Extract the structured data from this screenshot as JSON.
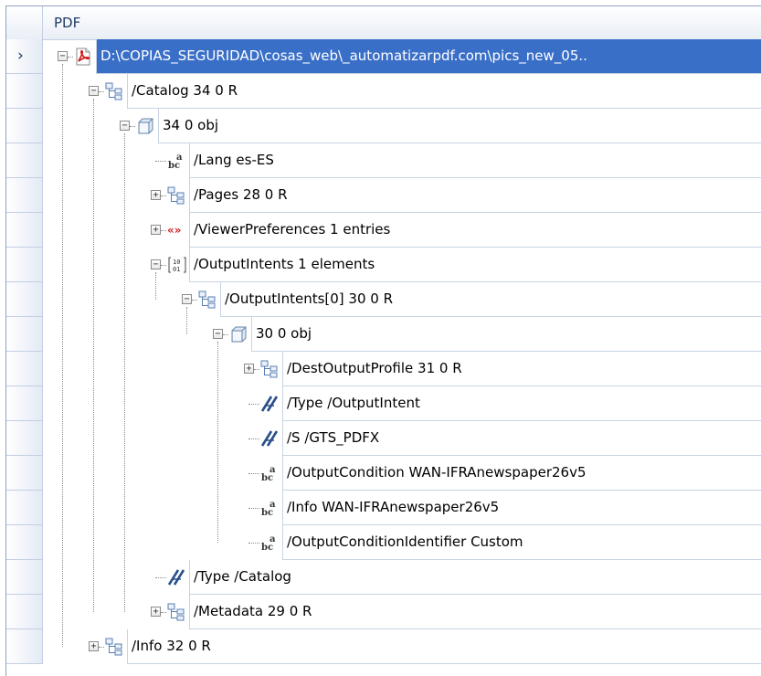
{
  "header": {
    "title": "PDF"
  },
  "rows": [
    {
      "label": "D:\\COPIAS_SEGURIDAD\\cosas_web\\_automatizarpdf.com\\pics_new_05..",
      "icon": "pdf-file-icon",
      "selected": true
    },
    {
      "label": "/Catalog 34 0 R",
      "icon": "reference-icon"
    },
    {
      "label": "34 0 obj",
      "icon": "object-cube-icon"
    },
    {
      "label": "/Lang es-ES",
      "icon": "string-abc-icon"
    },
    {
      "label": "/Pages 28 0 R",
      "icon": "reference-icon"
    },
    {
      "label": "/ViewerPreferences 1 entries",
      "icon": "dictionary-icon"
    },
    {
      "label": "/OutputIntents 1 elements",
      "icon": "array-icon"
    },
    {
      "label": "/OutputIntents[0] 30 0 R",
      "icon": "reference-icon"
    },
    {
      "label": "30 0 obj",
      "icon": "object-cube-icon"
    },
    {
      "label": "/DestOutputProfile 31 0 R",
      "icon": "reference-icon"
    },
    {
      "label": "/Type /OutputIntent",
      "icon": "name-icon"
    },
    {
      "label": "/S /GTS_PDFX",
      "icon": "name-icon"
    },
    {
      "label": "/OutputCondition WAN-IFRAnewspaper26v5",
      "icon": "string-abc-icon"
    },
    {
      "label": "/Info WAN-IFRAnewspaper26v5",
      "icon": "string-abc-icon"
    },
    {
      "label": "/OutputConditionIdentifier Custom",
      "icon": "string-abc-icon"
    },
    {
      "label": "/Type /Catalog",
      "icon": "name-icon"
    },
    {
      "label": "/Metadata 29 0 R",
      "icon": "reference-icon"
    },
    {
      "label": "/Info 32 0 R",
      "icon": "reference-icon"
    }
  ],
  "colors": {
    "selection": "#3a6fc8",
    "header_text": "#1e3b66",
    "grid": "#c3cfe2"
  }
}
